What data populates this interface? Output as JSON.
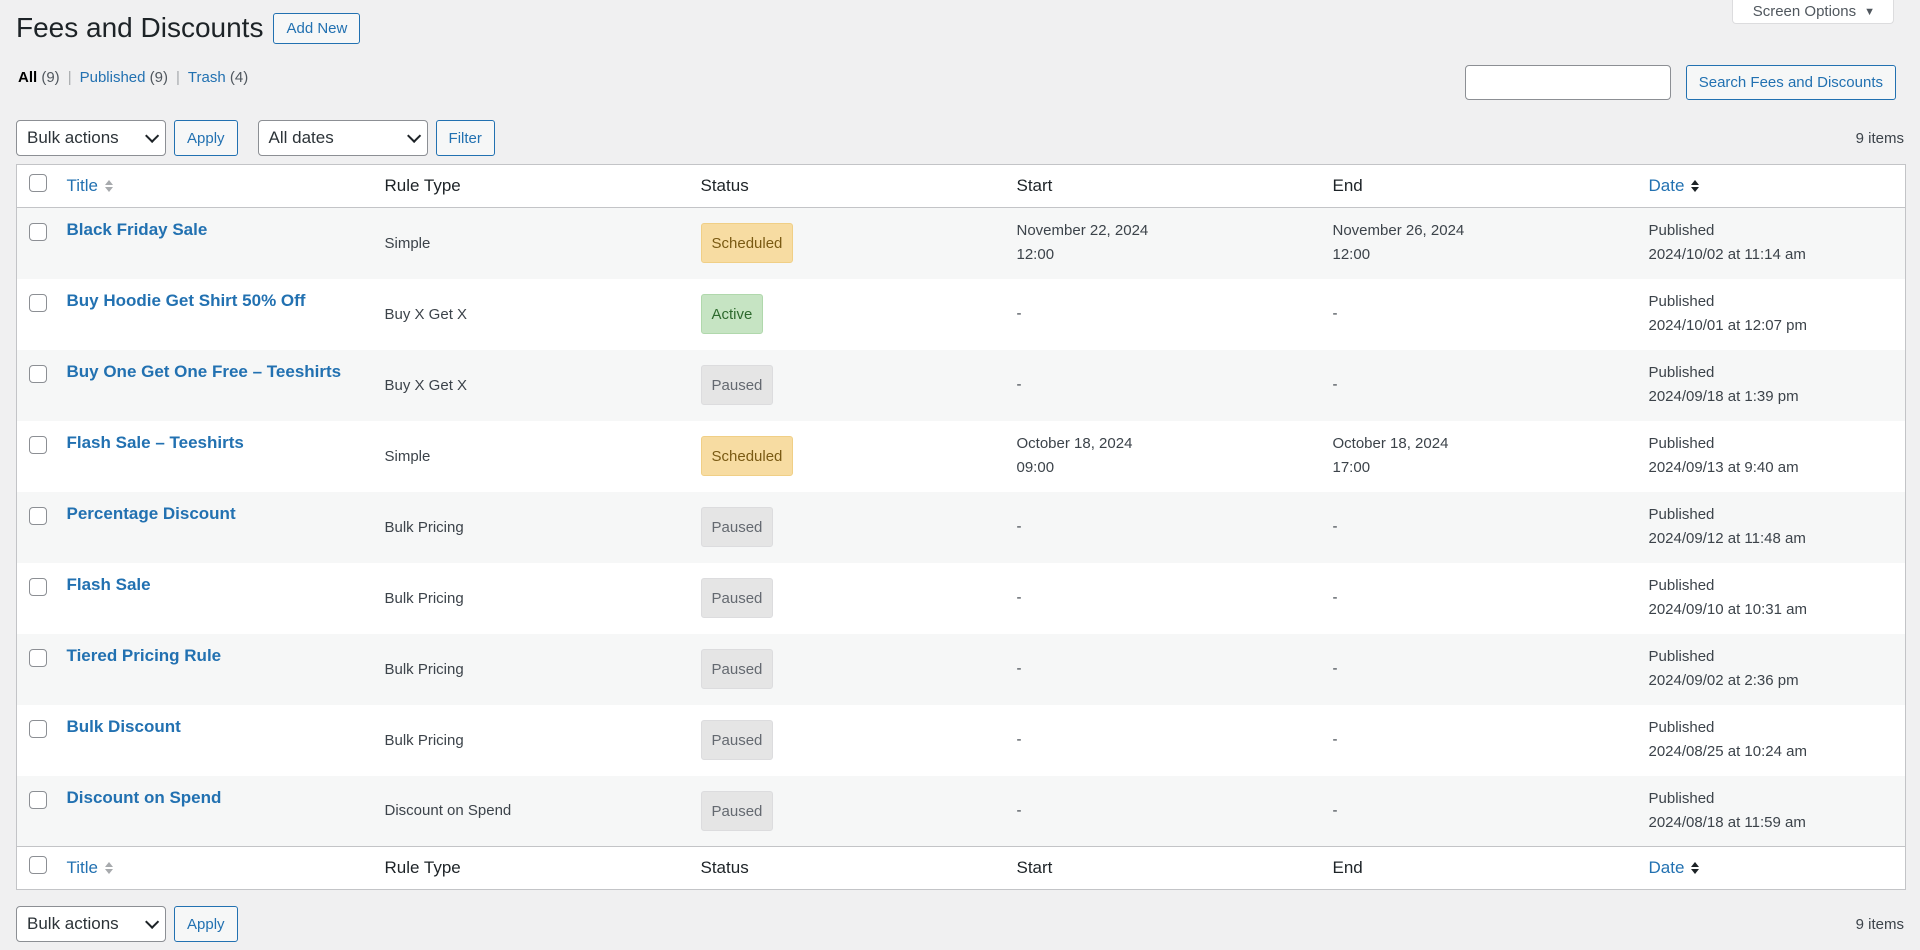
{
  "screen_options": {
    "label": "Screen Options",
    "arrow": "▼"
  },
  "header": {
    "title": "Fees and Discounts",
    "add_new": "Add New"
  },
  "views": [
    {
      "label": "All",
      "count": "(9)",
      "current": true
    },
    {
      "label": "Published",
      "count": "(9)",
      "current": false
    },
    {
      "label": "Trash",
      "count": "(4)",
      "current": false
    }
  ],
  "search": {
    "value": "",
    "placeholder": "",
    "button": "Search Fees and Discounts"
  },
  "tablenav_top": {
    "bulk_actions": "Bulk actions",
    "apply": "Apply",
    "dates": "All dates",
    "filter": "Filter",
    "items_count": "9 items"
  },
  "tablenav_bottom": {
    "bulk_actions": "Bulk actions",
    "apply": "Apply",
    "items_count": "9 items"
  },
  "columns": {
    "title": "Title",
    "rule_type": "Rule Type",
    "status": "Status",
    "start": "Start",
    "end": "End",
    "date": "Date"
  },
  "status_colors": {
    "scheduled": "#f7dca2",
    "active": "#c6e4c3",
    "paused": "#e5e5e5"
  },
  "rows": [
    {
      "title": "Black Friday Sale",
      "rule_type": "Simple",
      "status": "Scheduled",
      "status_key": "scheduled",
      "start_date": "November 22, 2024",
      "start_time": "12:00",
      "end_date": "November 26, 2024",
      "end_time": "12:00",
      "date_status": "Published",
      "date_value": "2024/10/02 at 11:14 am"
    },
    {
      "title": "Buy Hoodie Get Shirt 50% Off",
      "rule_type": "Buy X Get X",
      "status": "Active",
      "status_key": "active",
      "start_date": "-",
      "start_time": "",
      "end_date": "-",
      "end_time": "",
      "date_status": "Published",
      "date_value": "2024/10/01 at 12:07 pm"
    },
    {
      "title": "Buy One Get One Free – Teeshirts",
      "rule_type": "Buy X Get X",
      "status": "Paused",
      "status_key": "paused",
      "start_date": "-",
      "start_time": "",
      "end_date": "-",
      "end_time": "",
      "date_status": "Published",
      "date_value": "2024/09/18 at 1:39 pm"
    },
    {
      "title": "Flash Sale – Teeshirts",
      "rule_type": "Simple",
      "status": "Scheduled",
      "status_key": "scheduled",
      "start_date": "October 18, 2024",
      "start_time": "09:00",
      "end_date": "October 18, 2024",
      "end_time": "17:00",
      "date_status": "Published",
      "date_value": "2024/09/13 at 9:40 am"
    },
    {
      "title": "Percentage Discount",
      "rule_type": "Bulk Pricing",
      "status": "Paused",
      "status_key": "paused",
      "start_date": "-",
      "start_time": "",
      "end_date": "-",
      "end_time": "",
      "date_status": "Published",
      "date_value": "2024/09/12 at 11:48 am"
    },
    {
      "title": "Flash Sale",
      "rule_type": "Bulk Pricing",
      "status": "Paused",
      "status_key": "paused",
      "start_date": "-",
      "start_time": "",
      "end_date": "-",
      "end_time": "",
      "date_status": "Published",
      "date_value": "2024/09/10 at 10:31 am"
    },
    {
      "title": "Tiered Pricing Rule",
      "rule_type": "Bulk Pricing",
      "status": "Paused",
      "status_key": "paused",
      "start_date": "-",
      "start_time": "",
      "end_date": "-",
      "end_time": "",
      "date_status": "Published",
      "date_value": "2024/09/02 at 2:36 pm"
    },
    {
      "title": "Bulk Discount",
      "rule_type": "Bulk Pricing",
      "status": "Paused",
      "status_key": "paused",
      "start_date": "-",
      "start_time": "",
      "end_date": "-",
      "end_time": "",
      "date_status": "Published",
      "date_value": "2024/08/25 at 10:24 am"
    },
    {
      "title": "Discount on Spend",
      "rule_type": "Discount on Spend",
      "status": "Paused",
      "status_key": "paused",
      "start_date": "-",
      "start_time": "",
      "end_date": "-",
      "end_time": "",
      "date_status": "Published",
      "date_value": "2024/08/18 at 11:59 am"
    }
  ]
}
